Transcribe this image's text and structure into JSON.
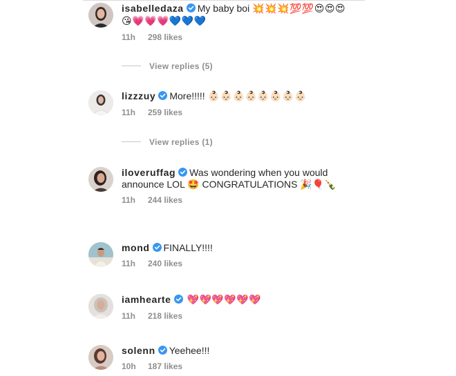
{
  "comments": [
    {
      "username": "isabelledaza",
      "text": "My baby boi",
      "emojis": "💥💥💥💯💯😍😍😍😘💗💗💗💙💙💙",
      "time": "11h",
      "likes": "298 likes",
      "verified": true,
      "view_replies": "View replies (5)"
    },
    {
      "username": "lizzzuy",
      "text": "More!!!!!",
      "emojis": "👶🏻👶🏻👶🏻👶🏻👶🏻👶🏻👶🏻👶🏻",
      "time": "11h",
      "likes": "259 likes",
      "verified": true,
      "view_replies": "View replies (1)"
    },
    {
      "username": "iloveruffag",
      "text": "Was wondering when you would announce LOL 🤩 CONGRATULATIONS 🎉🎈🍾",
      "time": "11h",
      "likes": "244 likes",
      "verified": true
    },
    {
      "username": "mond",
      "text": "FINALLY!!!!",
      "time": "11h",
      "likes": "240 likes",
      "verified": true
    },
    {
      "username": "iamhearte",
      "text": "",
      "emojis": "💖💖💖💖💖💖",
      "time": "11h",
      "likes": "218 likes",
      "verified": true
    },
    {
      "username": "solenn",
      "text": "Yeehee!!!",
      "time": "10h",
      "likes": "187 likes",
      "verified": true
    }
  ],
  "colors": {
    "verified": "#3897f0",
    "meta": "#8e8e8e",
    "text": "#262626"
  },
  "icons": {
    "verified": "verified-badge-icon"
  }
}
